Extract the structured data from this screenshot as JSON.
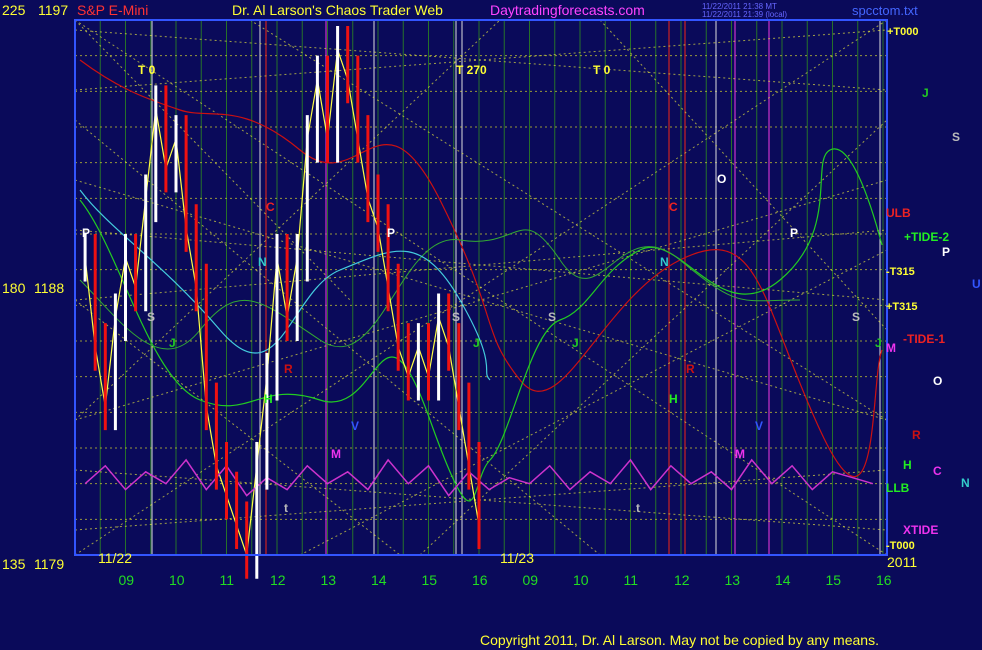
{
  "header": {
    "scale_top": "225",
    "price_top": "1197",
    "instrument": "S&P E-Mini",
    "title": "Dr. Al Larson's Chaos Trader Web",
    "site": "Daytradingforecasts.com",
    "timestamp_1": "11/22/2011 21:38 MT",
    "timestamp_2": "11/22/2011 21:39 (local)",
    "filename": "spcctom.txt"
  },
  "left_axis": [
    {
      "scale": "225",
      "price": "1197"
    },
    {
      "scale": "180",
      "price": "1188"
    },
    {
      "scale": "135",
      "price": "1179"
    }
  ],
  "dates": {
    "day1": "11/22",
    "day2": "11/23",
    "year": "2011"
  },
  "x_ticks": [
    "09",
    "10",
    "11",
    "12",
    "13",
    "14",
    "15",
    "16",
    "09",
    "10",
    "11",
    "12",
    "13",
    "14",
    "15",
    "16"
  ],
  "right_labels": {
    "t000_plus": "+T000",
    "j": "J",
    "s": "S",
    "ulb": "ULB",
    "tide2": "+TIDE-2",
    "p": "P",
    "t315_minus": "-T315",
    "u": "U",
    "t315_plus": "+T315",
    "tide1": "-TIDE-1",
    "m": "M",
    "o": "O",
    "r": "R",
    "h": "H",
    "c": "C",
    "n": "N",
    "llb": "LLB",
    "xtide": "XTIDE",
    "t000_minus": "-T000"
  },
  "plot_labels": {
    "t0_a": "T  0",
    "t270": "T  270",
    "t0_b": "T  0",
    "p": "P",
    "s": "S",
    "j": "J",
    "c": "C",
    "n": "N",
    "h": "H",
    "r": "R",
    "v": "V",
    "m": "M",
    "o": "O",
    "t": "t"
  },
  "footer": {
    "copyright": "Copyright 2011, Dr. Al Larson. May not be copied by any means."
  },
  "colors": {
    "background": "#0a0a5a",
    "grid_green": "#2e8b1e",
    "grid_yellow": "#c8c830",
    "price_up": "#ffffff",
    "price_down": "#ee1111",
    "xtide": "#cc33cc",
    "red_flux": "#cc1111",
    "green_flux": "#22cc22",
    "cyan_avg": "#44ccdd",
    "yellow_avg": "#ffff44"
  },
  "chart_data": {
    "type": "line",
    "title": "Dr. Al Larson's Chaos Trader Web",
    "instrument": "S&P E-Mini",
    "ylim_price": [
      1179,
      1197
    ],
    "ylim_scale": [
      135,
      225
    ],
    "x_ticks": [
      "09",
      "10",
      "11",
      "12",
      "13",
      "14",
      "15",
      "16",
      "09",
      "10",
      "11",
      "12",
      "13",
      "14",
      "15",
      "16"
    ],
    "price_series": {
      "name": "S&P E-Mini",
      "hour": [
        8.2,
        8.4,
        8.6,
        8.8,
        9.0,
        9.2,
        9.4,
        9.6,
        9.8,
        10.0,
        10.2,
        10.4,
        10.6,
        10.8,
        11.0,
        11.2,
        11.4,
        11.6,
        11.8,
        12.0,
        12.2,
        12.4,
        12.6,
        12.8,
        13.0,
        13.2,
        13.4,
        13.6,
        13.8,
        14.0,
        14.2,
        14.4,
        14.6,
        14.8,
        15.0,
        15.2,
        15.4,
        15.6,
        15.8,
        16.0
      ],
      "price": [
        1189,
        1186,
        1184,
        1187,
        1189,
        1188,
        1191,
        1194,
        1192,
        1193,
        1190,
        1188,
        1184,
        1182,
        1181,
        1180,
        1179,
        1182,
        1185,
        1189,
        1187,
        1189,
        1193,
        1195,
        1193,
        1196,
        1195,
        1193,
        1191,
        1190,
        1188,
        1186,
        1185,
        1186,
        1185,
        1187,
        1186,
        1184,
        1182,
        1180
      ]
    },
    "xtide_series": {
      "name": "XTIDE",
      "hour": [
        8.2,
        8.6,
        9.0,
        9.4,
        9.8,
        10.2,
        10.6,
        11.0,
        11.4,
        11.8,
        12.2,
        12.6,
        13.0,
        13.4,
        13.8,
        14.2,
        14.6,
        15.0,
        15.4,
        15.8,
        16.2,
        16.6,
        17.0,
        17.4,
        17.8,
        18.2,
        18.6,
        19.0,
        19.4,
        19.8,
        20.2,
        20.6,
        21.0,
        21.4,
        21.8,
        22.2,
        22.6,
        23.0,
        23.4,
        23.8
      ],
      "scale": [
        147,
        150,
        146,
        149,
        147,
        151,
        146,
        150,
        145,
        148,
        146,
        150,
        147,
        149,
        146,
        151,
        147,
        150,
        145,
        149,
        146,
        148,
        147,
        150,
        146,
        149,
        147,
        151,
        146,
        150,
        147,
        149,
        146,
        151,
        147,
        150,
        146,
        149,
        148,
        147
      ]
    }
  }
}
